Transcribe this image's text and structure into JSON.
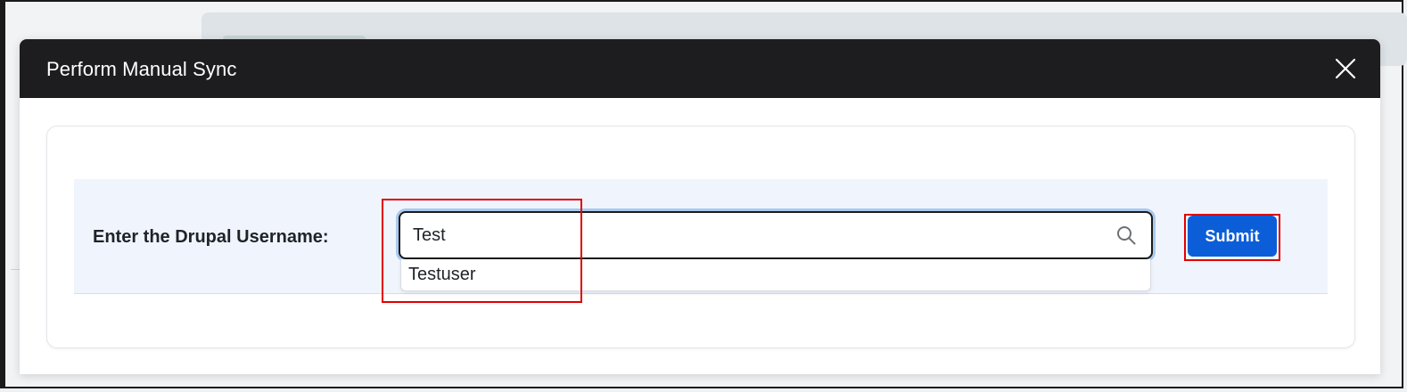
{
  "modal": {
    "title": "Perform Manual Sync",
    "close_icon": "close-icon"
  },
  "form": {
    "label": "Enter the Drupal Username:",
    "search": {
      "value": "Test",
      "icon": "search-icon"
    },
    "suggestions": [
      "Testuser"
    ],
    "submit_label": "Submit"
  },
  "colors": {
    "header_bg": "#1d1d1f",
    "submit_bg": "#0b5ed7",
    "form_row_bg": "#f0f5fd",
    "annotation_red": "#e00000",
    "focus_ring": "#a9c8ee"
  }
}
